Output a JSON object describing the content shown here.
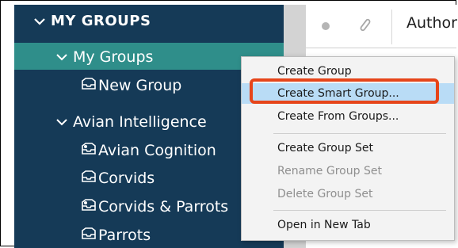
{
  "sidebar": {
    "header": "MY GROUPS",
    "items": [
      {
        "label": "My Groups",
        "level": 1,
        "expandable": true,
        "selected": true
      },
      {
        "label": "New Group",
        "level": 2,
        "expandable": false,
        "selected": false
      },
      {
        "label": "Avian Intelligence",
        "level": 1,
        "expandable": true,
        "selected": false
      },
      {
        "label": "Avian Cognition",
        "level": 2,
        "expandable": false,
        "selected": false
      },
      {
        "label": "Corvids",
        "level": 2,
        "expandable": false,
        "selected": false
      },
      {
        "label": "Corvids & Parrots",
        "level": 2,
        "expandable": false,
        "selected": false
      },
      {
        "label": "Parrots",
        "level": 2,
        "expandable": false,
        "selected": false
      }
    ]
  },
  "table_header": {
    "author_label": "Author"
  },
  "context_menu": {
    "items": [
      {
        "label": "Create Group",
        "enabled": true
      },
      {
        "label": "Create Smart Group...",
        "enabled": true,
        "highlighted": true
      },
      {
        "label": "Create From Groups...",
        "enabled": true
      },
      {
        "label": "Create Group Set",
        "enabled": true
      },
      {
        "label": "Rename Group Set",
        "enabled": false
      },
      {
        "label": "Delete Group Set",
        "enabled": false
      },
      {
        "label": "Open in New Tab",
        "enabled": true
      }
    ]
  },
  "colors": {
    "sidebar_bg": "#153a57",
    "selected_row_bg": "#2f8e8a",
    "menu_hover_bg": "#b9dcf6",
    "callout_border": "#e6451a"
  }
}
